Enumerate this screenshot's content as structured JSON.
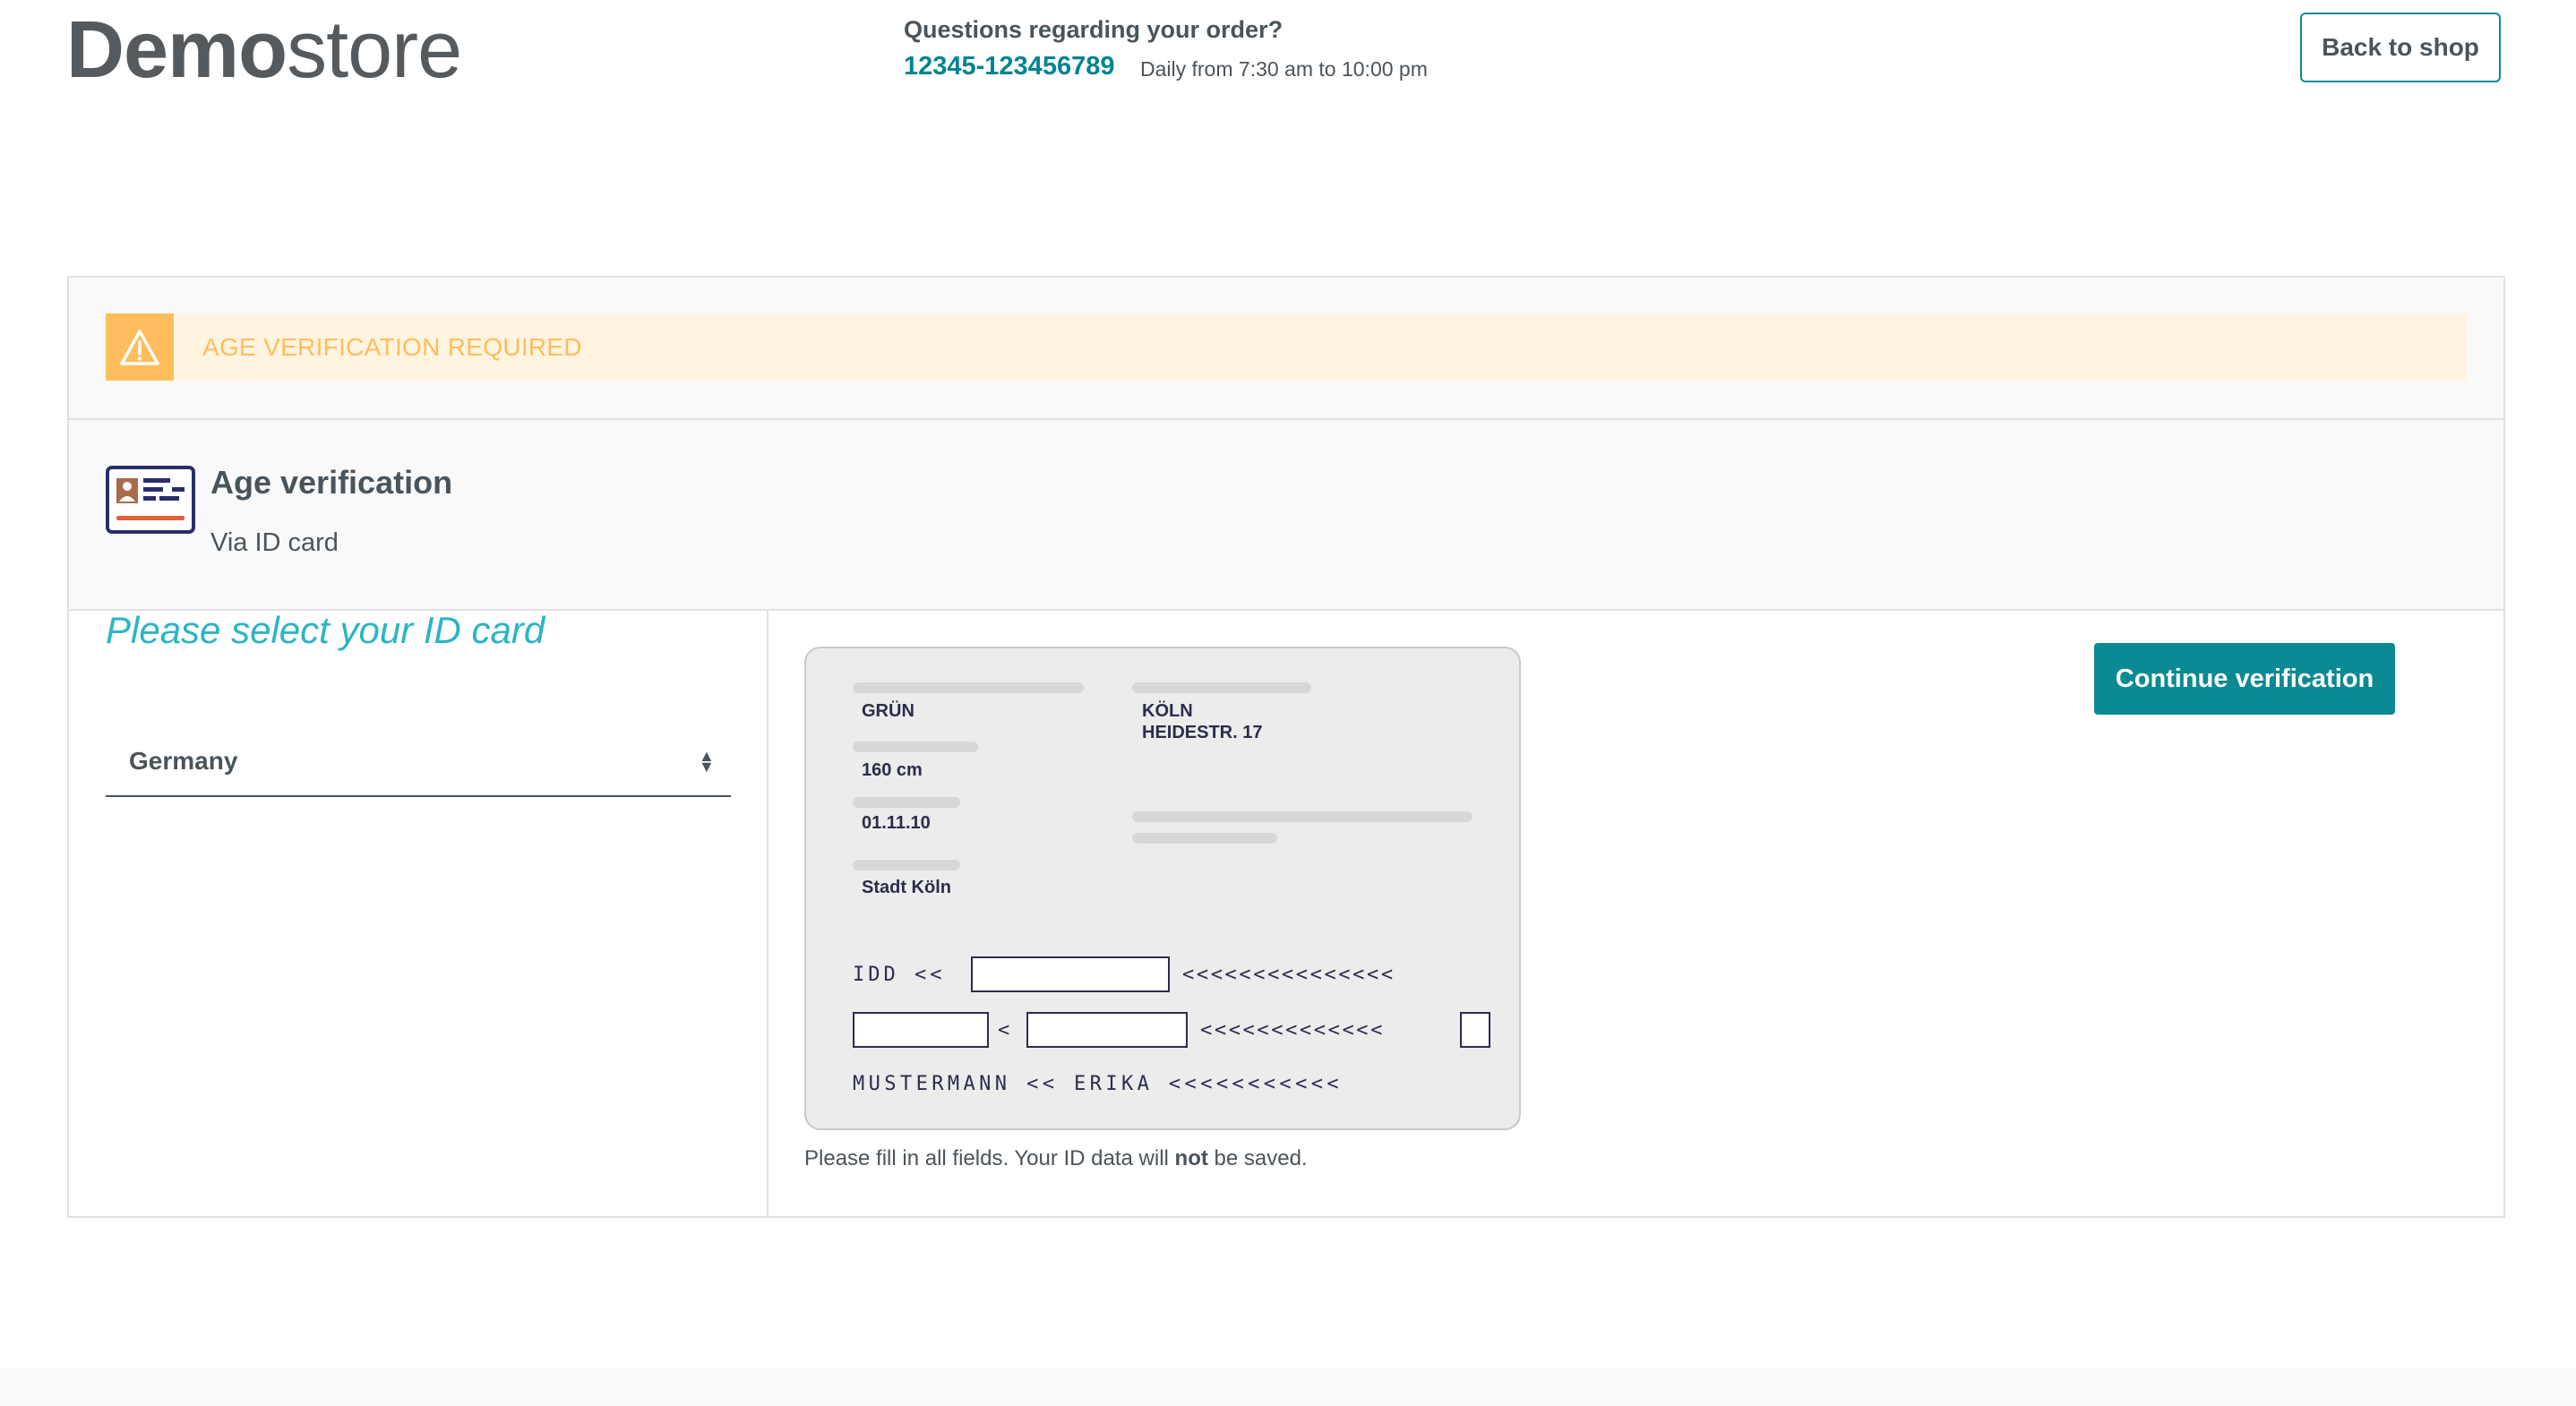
{
  "header": {
    "logo_bold": "Demo",
    "logo_light": "store",
    "hotline_question": "Questions regarding your order?",
    "hotline_number": "12345-123456789",
    "hotline_hours": "Daily from 7:30 am to 10:00 pm",
    "back_to_shop": "Back to shop"
  },
  "alert": {
    "text": "AGE VERIFICATION REQUIRED",
    "icon": "warning-icon",
    "color": "#ffbd5d",
    "background": "#fff4e0"
  },
  "method": {
    "icon": "id-card-icon",
    "title": "Age verification",
    "subtitle": "Via ID card"
  },
  "selection": {
    "heading": "Please select your ID card",
    "country": "Germany"
  },
  "id_card": {
    "eye_color": "GRÜN",
    "height": "160 cm",
    "issue_date": "01.11.10",
    "authority": "Stadt Köln",
    "city": "KÖLN",
    "street": "HEIDESTR. 17",
    "mrz_line1_prefix": "IDD <<",
    "mrz_line1_fill": "<<<<<<<<<<<<<<<",
    "mrz_line2_sep": "<",
    "mrz_line2_fill": "<<<<<<<<<<<<<",
    "mrz_line3": "MUSTERMANN << ERIKA <<<<<<<<<<<"
  },
  "hint": {
    "prefix": "Please fill in all fields. Your ID data will ",
    "emphasis": "not",
    "suffix": " be saved."
  },
  "continue_button": "Continue verification",
  "colors": {
    "accent": "#0b8a93",
    "heading_accent": "#2bb5c3",
    "text": "#4a545b"
  }
}
